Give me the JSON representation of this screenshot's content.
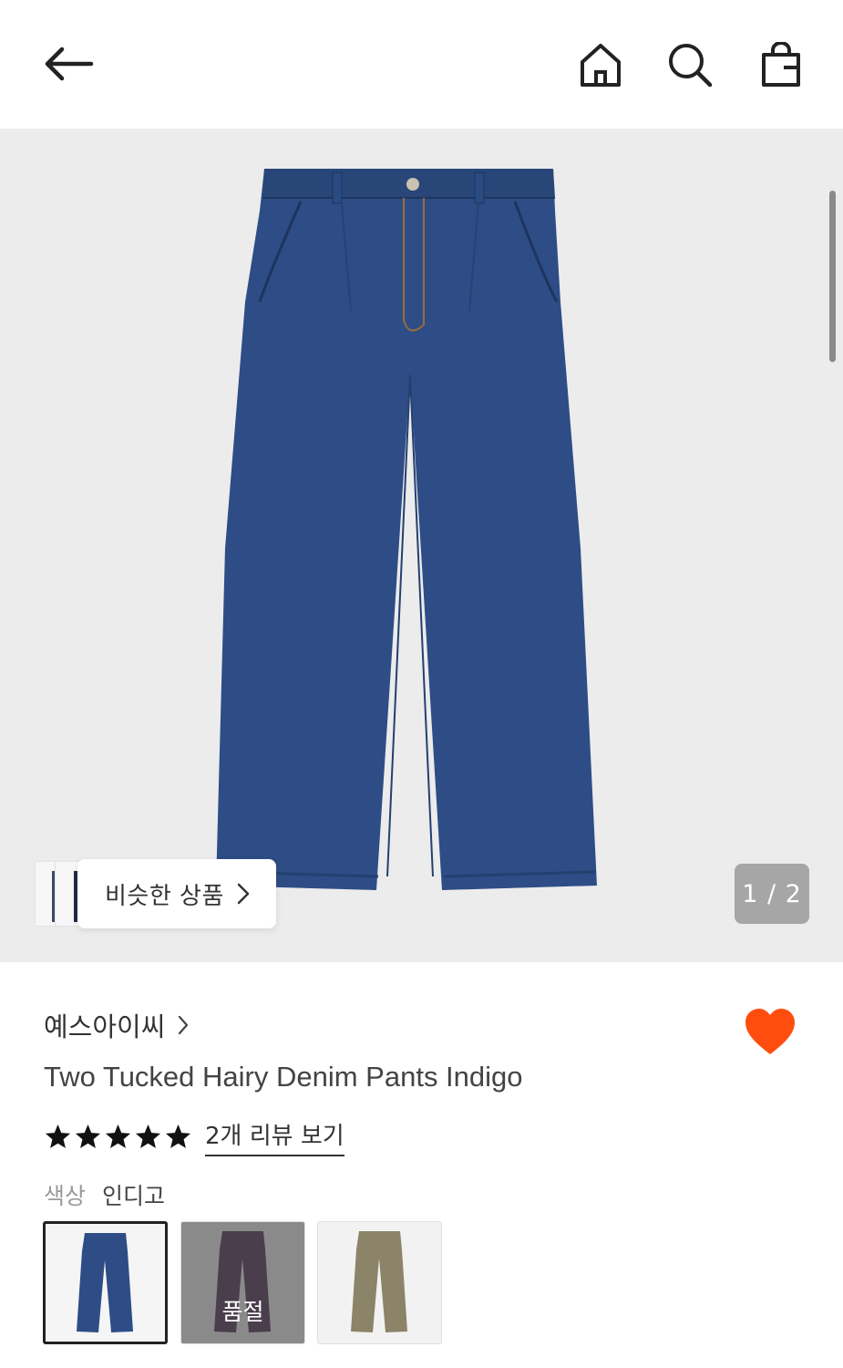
{
  "header": {
    "back_icon": "back-arrow-icon",
    "home_icon": "home-icon",
    "search_icon": "search-icon",
    "bag_icon": "shopping-bag-icon"
  },
  "gallery": {
    "similar_label": "비슷한 상품",
    "page_indicator": "1 / 2",
    "denim_color": "#2e4d86"
  },
  "product": {
    "brand": "예스아이씨",
    "title": "Two Tucked Hairy Denim Pants Indigo",
    "rating": 5,
    "review_link": "2개 리뷰 보기",
    "color_key": "색상",
    "color_value": "인디고",
    "heart_color": "#ff4d0f",
    "swatches": [
      {
        "color": "#2e4d86",
        "selected": true,
        "sold_out": false
      },
      {
        "color": "#4a3d4c",
        "selected": false,
        "sold_out": true,
        "sold_out_label": "품절"
      },
      {
        "color": "#8c8468",
        "selected": false,
        "sold_out": false
      }
    ]
  }
}
